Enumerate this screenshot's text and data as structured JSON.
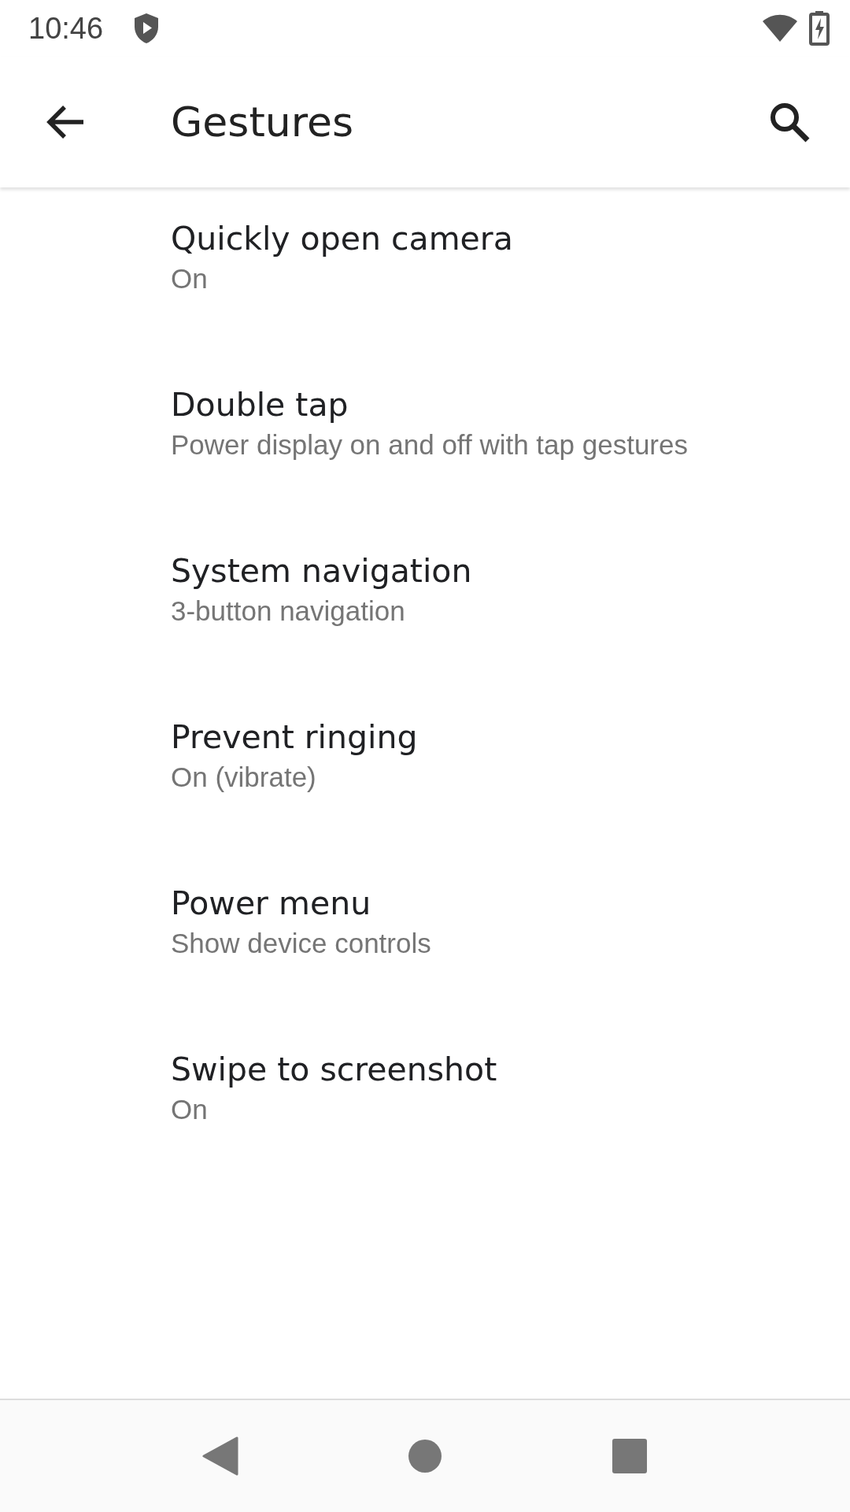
{
  "status_bar": {
    "time": "10:46"
  },
  "app_bar": {
    "title": "Gestures"
  },
  "items": [
    {
      "title": "Quickly open camera",
      "summary": "On"
    },
    {
      "title": "Double tap",
      "summary": "Power display on and off with tap gestures"
    },
    {
      "title": "System navigation",
      "summary": "3-button navigation"
    },
    {
      "title": "Prevent ringing",
      "summary": "On (vibrate)"
    },
    {
      "title": "Power menu",
      "summary": "Show device controls"
    },
    {
      "title": "Swipe to screenshot",
      "summary": "On"
    }
  ]
}
